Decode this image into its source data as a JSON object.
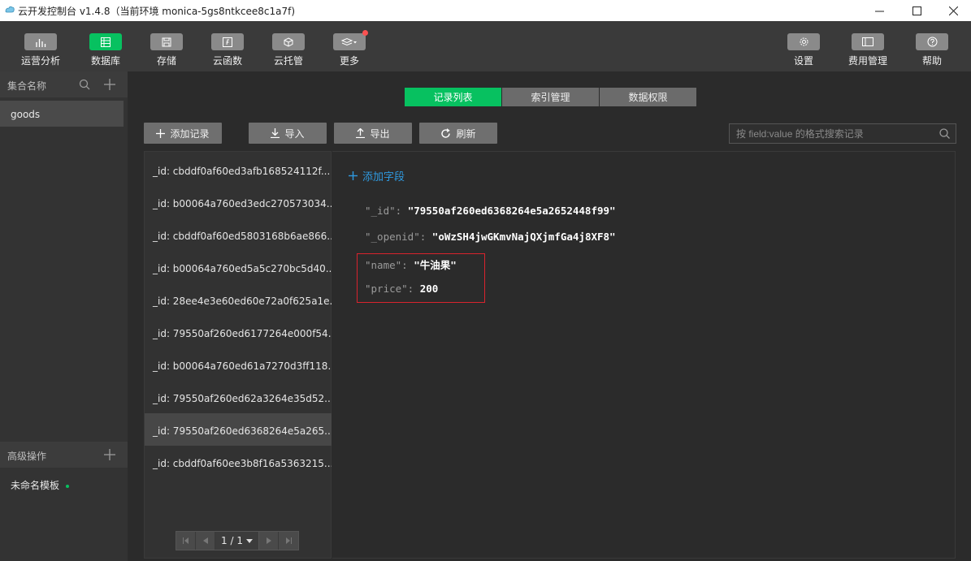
{
  "window": {
    "title": "云开发控制台 v1.4.8（当前环境 monica-5gs8ntkcee8c1a7f)"
  },
  "toolbar": {
    "items": [
      {
        "label": "运营分析",
        "icon": "chart-icon"
      },
      {
        "label": "数据库",
        "icon": "database-icon"
      },
      {
        "label": "存储",
        "icon": "storage-icon"
      },
      {
        "label": "云函数",
        "icon": "function-icon"
      },
      {
        "label": "云托管",
        "icon": "cube-icon"
      },
      {
        "label": "更多",
        "icon": "layers-icon"
      }
    ],
    "right_items": [
      {
        "label": "设置",
        "icon": "gear-icon"
      },
      {
        "label": "费用管理",
        "icon": "card-icon"
      },
      {
        "label": "帮助",
        "icon": "help-icon"
      }
    ]
  },
  "sidebar": {
    "collections_header": "集合名称",
    "collections": [
      "goods"
    ],
    "advanced_header": "高级操作",
    "template": "未命名模板"
  },
  "main": {
    "tabs": [
      "记录列表",
      "索引管理",
      "数据权限"
    ],
    "actions": [
      "添加记录",
      "导入",
      "导出",
      "刷新"
    ],
    "search_placeholder": "按 field:value 的格式搜索记录",
    "records": [
      "_id: cbddf0af60ed3afb168524112f...",
      "_id: b00064a760ed3edc270573034...",
      "_id: cbddf0af60ed5803168b6ae866...",
      "_id: b00064a760ed5a5c270bc5d40...",
      "_id: 28ee4e3e60ed60e72a0f625a1e...",
      "_id: 79550af260ed6177264e000f54...",
      "_id: b00064a760ed61a7270d3ff118...",
      "_id: 79550af260ed62a3264e35d52...",
      "_id: 79550af260ed6368264e5a265...",
      "_id: cbddf0af60ee3b8f16a5363215..."
    ],
    "pagination": "1 / 1",
    "add_field": "添加字段",
    "fields": [
      {
        "key": "\"_id\":",
        "value": "\"79550af260ed6368264e5a2652448f99\""
      },
      {
        "key": "\"_openid\":",
        "value": "\"oWzSH4jwGKmvNajQXjmfGa4j8XF8\""
      },
      {
        "key": "\"name\":",
        "value": "\"牛油果\""
      },
      {
        "key": "\"price\":",
        "value": "200"
      }
    ]
  },
  "colors": {
    "accent": "#07c160",
    "link": "#2f9ae0",
    "highlight_border": "#d9232d",
    "notification_dot": "#fa5151"
  }
}
